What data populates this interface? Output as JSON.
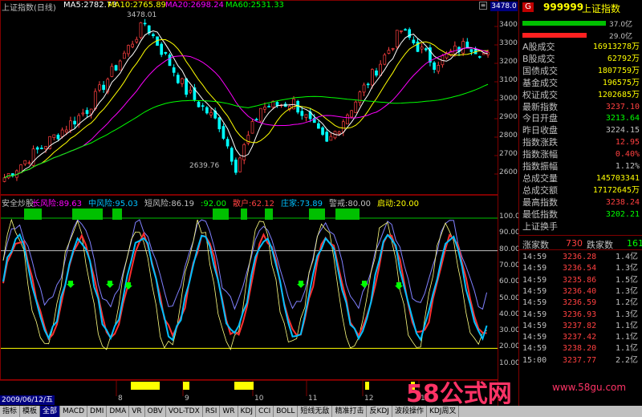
{
  "header": {
    "index_name": "上证指数(日线)",
    "ma5": "MA5:2782.73",
    "ma10": "MA10:2765.89",
    "ma20": "MA20:2698.24",
    "ma60": "MA60:2531.33",
    "price_box": "3478.0",
    "code": "999999",
    "name": "上证指数",
    "g_badge": "G"
  },
  "annotations": {
    "high": "3478.01",
    "low": "2639.76"
  },
  "axis": {
    "main_ticks": [
      "3400",
      "3300",
      "3200",
      "3100",
      "3000",
      "2900",
      "2800",
      "2700",
      "2600"
    ],
    "ind_ticks": [
      "100.00",
      "90.00",
      "80.00",
      "70.00",
      "60.00",
      "50.00",
      "40.00",
      "30.00",
      "20.00",
      "10.00"
    ],
    "months": [
      "8",
      "9",
      "10",
      "11",
      "12",
      "1"
    ],
    "date": "2009/06/12/五"
  },
  "indicator": {
    "name": "安全炒股",
    "items": [
      {
        "label": "长风险:89.63",
        "color": "#ff00ff"
      },
      {
        "label": "中风险:95.03",
        "color": "#00c0ff"
      },
      {
        "label": "短风险:86.19",
        "color": "#c0c0c0"
      },
      {
        "label": ":92.00",
        "color": "#00ff00"
      },
      {
        "label": "散户:62.12",
        "color": "#ff4040"
      },
      {
        "label": "庄家:73.89",
        "color": "#00c0ff"
      },
      {
        "label": "警戒:80.00",
        "color": "#c0c0c0"
      },
      {
        "label": "启动:20.00",
        "color": "#ffff00"
      }
    ]
  },
  "volume_bars": {
    "up_label": "37.0亿",
    "down_label": "29.0亿"
  },
  "stats": [
    {
      "label": "A股成交",
      "value": "16913278万",
      "color": "#ffff00"
    },
    {
      "label": "B股成交",
      "value": "62792万",
      "color": "#ffff00"
    },
    {
      "label": "国债成交",
      "value": "1807759万",
      "color": "#ffff00"
    },
    {
      "label": "基金成交",
      "value": "196575万",
      "color": "#ffff00"
    },
    {
      "label": "权证成交",
      "value": "1202685万",
      "color": "#ffff00"
    },
    {
      "label": "最新指数",
      "value": "3237.10",
      "color": "#ff4040"
    },
    {
      "label": "今日开盘",
      "value": "3213.64",
      "color": "#00ff00"
    },
    {
      "label": "昨日收盘",
      "value": "3224.15",
      "color": "#c0c0c0"
    },
    {
      "label": "指数涨跌",
      "value": "12.95",
      "color": "#ff4040"
    },
    {
      "label": "指数涨幅",
      "value": "0.40%",
      "color": "#ff4040"
    },
    {
      "label": "指数振幅",
      "value": "1.12%",
      "color": "#c0c0c0"
    },
    {
      "label": "总成交量",
      "value": "145703341",
      "color": "#ffff00"
    },
    {
      "label": "总成交额",
      "value": "17172645万",
      "color": "#ffff00"
    },
    {
      "label": "最高指数",
      "value": "3238.24",
      "color": "#ff4040"
    },
    {
      "label": "最低指数",
      "value": "3202.21",
      "color": "#00ff00"
    },
    {
      "label": "上证换手",
      "value": "",
      "color": "#c0c0c0"
    }
  ],
  "breadth": {
    "up_label": "涨家数",
    "up_value": "730",
    "down_label": "跌家数",
    "down_value": "161"
  },
  "ticks": [
    {
      "time": "14:59",
      "price": "3236.28",
      "vol": "1.4亿"
    },
    {
      "time": "14:59",
      "price": "3236.54",
      "vol": "1.3亿"
    },
    {
      "time": "14:59",
      "price": "3235.86",
      "vol": "1.5亿"
    },
    {
      "time": "14:59",
      "price": "3236.40",
      "vol": "1.3亿"
    },
    {
      "time": "14:59",
      "price": "3236.59",
      "vol": "1.2亿"
    },
    {
      "time": "14:59",
      "price": "3236.93",
      "vol": "1.3亿"
    },
    {
      "time": "14:59",
      "price": "3237.82",
      "vol": "1.1亿"
    },
    {
      "time": "14:59",
      "price": "3237.42",
      "vol": "1.1亿"
    },
    {
      "time": "14:59",
      "price": "3238.20",
      "vol": "1.1亿"
    },
    {
      "time": "15:00",
      "price": "3237.77",
      "vol": "2.2亿"
    }
  ],
  "tabs": [
    "指标",
    "模板",
    "全部",
    "MACD",
    "DMI",
    "DMA",
    "VR",
    "OBV",
    "VOL-TDX",
    "RSI",
    "WR",
    "KDJ",
    "CCI",
    "BOLL",
    "短线无敌",
    "精准打击",
    "反KDJ",
    "波段操作",
    "KDJ周叉"
  ],
  "watermark": {
    "big": "58公式网",
    "url": "www.58gu.com"
  },
  "colors": {
    "up": "#ff4040",
    "down": "#00ffff",
    "ma5": "#ffffff",
    "ma10": "#ffff00",
    "ma20": "#ff00ff",
    "ma60": "#00ff00"
  }
}
